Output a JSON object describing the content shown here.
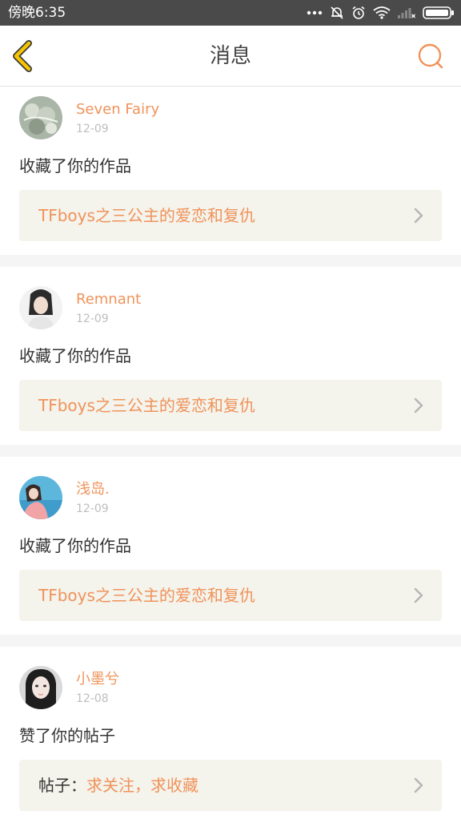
{
  "status_bar": {
    "time": "傍晚6:35",
    "icons": [
      "more-dots-icon",
      "notification-off-icon",
      "alarm-icon",
      "wifi-icon",
      "signal-icon",
      "battery-icon"
    ]
  },
  "header": {
    "title": "消息",
    "back_icon": "chevron-left-icon",
    "search_icon": "search-icon"
  },
  "colors": {
    "accent": "#f0935a",
    "back_arrow": "#f5c400",
    "link_box_bg": "#f4f3ec",
    "divider": "#f5f5f5"
  },
  "messages": [
    {
      "username": "Seven Fairy",
      "date": "12-09",
      "action": "收藏了你的作品",
      "link_prefix": "",
      "link_text": "TFboys之三公主的爱恋和复仇"
    },
    {
      "username": "Remnant",
      "date": "12-09",
      "action": "收藏了你的作品",
      "link_prefix": "",
      "link_text": "TFboys之三公主的爱恋和复仇"
    },
    {
      "username": "浅岛.",
      "date": "12-09",
      "action": "收藏了你的作品",
      "link_prefix": "",
      "link_text": "TFboys之三公主的爱恋和复仇"
    },
    {
      "username": "小墨兮",
      "date": "12-08",
      "action": "赞了你的帖子",
      "link_prefix": "帖子：",
      "link_text": "求关注，求收藏"
    }
  ]
}
